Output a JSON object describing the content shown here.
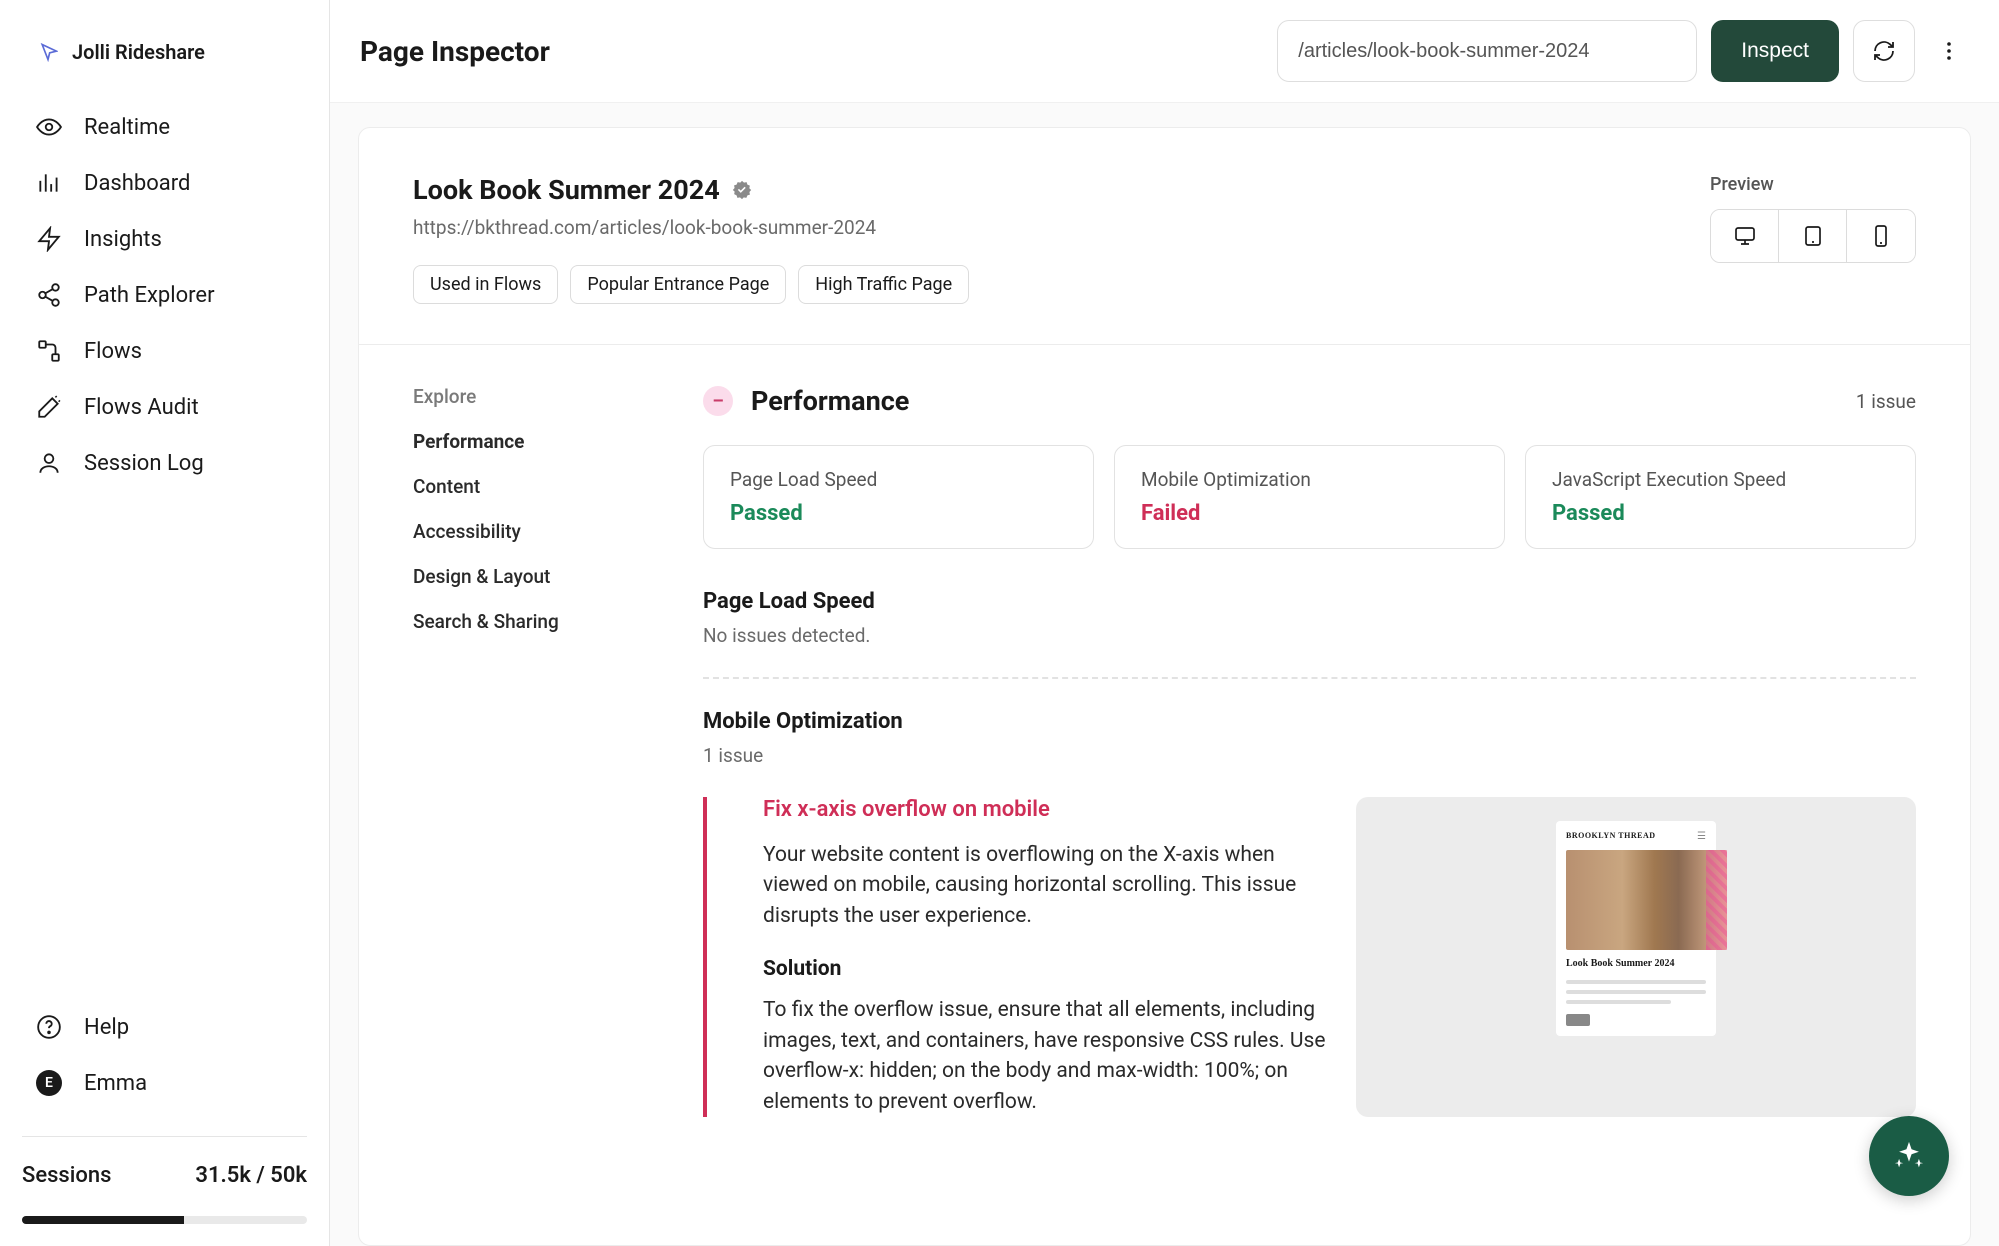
{
  "brand": {
    "name": "Jolli Rideshare"
  },
  "nav": {
    "items": [
      {
        "label": "Realtime"
      },
      {
        "label": "Dashboard"
      },
      {
        "label": "Insights"
      },
      {
        "label": "Path Explorer"
      },
      {
        "label": "Flows"
      },
      {
        "label": "Flows Audit"
      },
      {
        "label": "Session Log"
      }
    ],
    "help": "Help",
    "user_name": "Emma",
    "user_initial": "E"
  },
  "usage": {
    "label": "Sessions",
    "value": "31.5k / 50k"
  },
  "topbar": {
    "title": "Page Inspector",
    "url_value": "/articles/look-book-summer-2024",
    "inspect_label": "Inspect"
  },
  "page": {
    "title": "Look Book Summer 2024",
    "url": "https://bkthread.com/articles/look-book-summer-2024",
    "chips": [
      "Used in Flows",
      "Popular Entrance Page",
      "High Traffic Page"
    ],
    "preview_label": "Preview"
  },
  "explore": {
    "heading": "Explore",
    "items": [
      "Performance",
      "Content",
      "Accessibility",
      "Design & Layout",
      "Search & Sharing"
    ]
  },
  "performance": {
    "title": "Performance",
    "issue_summary": "1 issue",
    "metrics": [
      {
        "name": "Page Load Speed",
        "status": "Passed",
        "status_class": "passed"
      },
      {
        "name": "Mobile Optimization",
        "status": "Failed",
        "status_class": "failed"
      },
      {
        "name": "JavaScript Execution Speed",
        "status": "Passed",
        "status_class": "passed"
      }
    ],
    "page_load": {
      "title": "Page Load Speed",
      "text": "No issues detected."
    },
    "mobile_opt": {
      "title": "Mobile Optimization",
      "count": "1 issue"
    },
    "issue": {
      "title": "Fix x-axis overflow on mobile",
      "body": "Your website content is overflowing on the X-axis when viewed on mobile, causing horizontal scrolling. This issue disrupts the user experience.",
      "solution_heading": "Solution",
      "solution_body": "To fix the overflow issue, ensure that all elements, including images, text, and containers, have responsive CSS rules. Use overflow-x: hidden; on the body and max-width: 100%; on elements to prevent overflow."
    },
    "phone_preview": {
      "brand": "BROOKLYN THREAD",
      "title": "Look Book Summer 2024"
    }
  }
}
